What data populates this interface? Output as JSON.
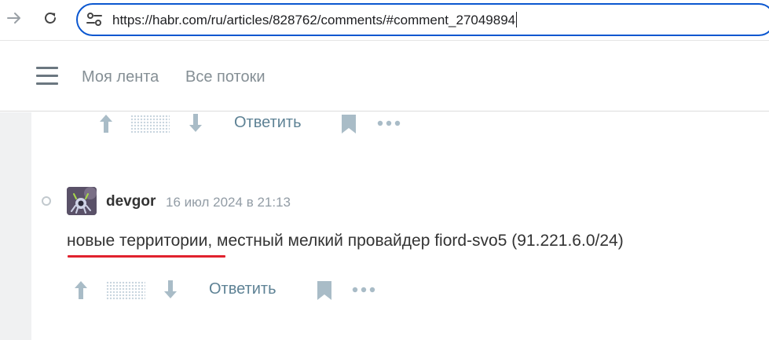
{
  "browser": {
    "url": "https://habr.com/ru/articles/828762/comments/#comment_27049894"
  },
  "header": {
    "nav": [
      "Моя лента",
      "Все потоки"
    ]
  },
  "comments": [
    {
      "reply_label": "Ответить"
    },
    {
      "author": "devgor",
      "timestamp": "16 июл 2024 в 21:13",
      "text": "новые территории, местный мелкий провайдер fiord-svo5 (91.221.6.0/24)",
      "reply_label": "Ответить"
    }
  ],
  "colors": {
    "url_focus": "#0b57d0",
    "link": "#5e8295",
    "icon": "#a9bcc7",
    "underline": "#e0222e"
  },
  "icons": [
    "back-arrow-icon",
    "reload-icon",
    "site-settings-icon",
    "menu-icon",
    "upvote-icon",
    "downvote-icon",
    "bookmark-icon",
    "more-icon"
  ]
}
